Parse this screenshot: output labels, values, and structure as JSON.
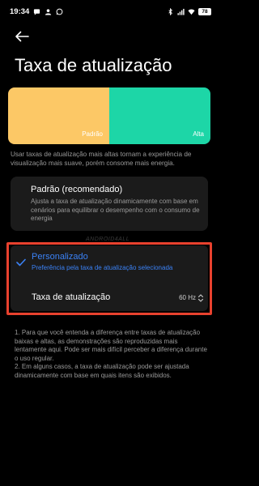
{
  "status_bar": {
    "time": "19:34",
    "battery": "78",
    "icons": [
      "message-icon",
      "contact-icon",
      "whatsapp-icon",
      "bluetooth-icon",
      "signal-icon",
      "wifi-icon",
      "battery-icon"
    ]
  },
  "header": {
    "back_icon": "back-arrow-icon",
    "title": "Taxa de atualização"
  },
  "preview": {
    "standard_label": "Padrão",
    "high_label": "Alta",
    "colors": {
      "standard": "#fcc866",
      "high": "#1dd6a7"
    }
  },
  "description": "Usar taxas de atualização mais altas tornam a experiência de visualização mais suave, porém consome mais energia.",
  "options": {
    "standard": {
      "title": "Padrão (recomendado)",
      "description": "Ajusta a taxa de atualização dinamicamente com base em cenários para equilibrar o desempenho com o consumo de energia",
      "selected": false
    },
    "custom": {
      "title": "Personalizado",
      "description": "Preferência pela taxa de atualização selecionada",
      "selected": true
    }
  },
  "refresh_rate": {
    "label": "Taxa de atualização",
    "value": "60 Hz"
  },
  "notes": [
    "1. Para que você entenda a diferença entre taxas de atualização baixas e altas, as demonstrações são reproduzidas mais lentamente aqui. Pode ser mais difícil perceber a diferença durante o uso regular.",
    "2. Em alguns casos, a taxa de atualização pode ser ajustada dinamicamente com base em quais itens são exibidos."
  ],
  "watermark": "ANDROID4ALL",
  "accent_color": "#3b82f6",
  "highlight_color": "#e8412e"
}
